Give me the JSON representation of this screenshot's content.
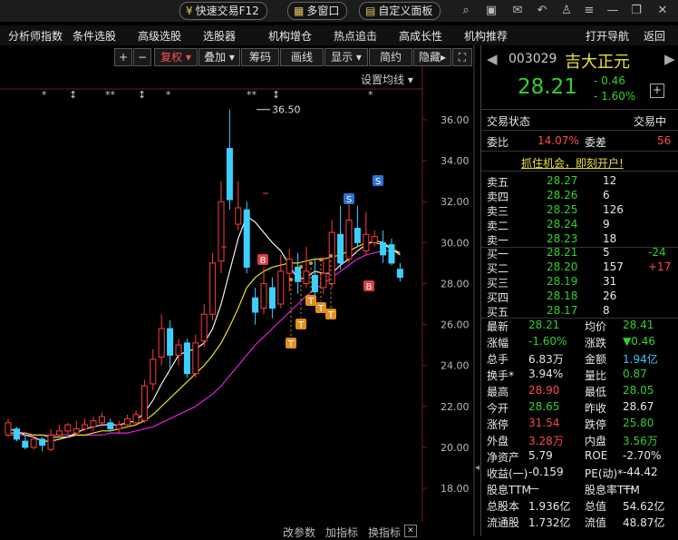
{
  "topbar": {
    "fast_trade": "快速交易F12",
    "multi_window": "多窗口",
    "custom_panel": "自定义面板"
  },
  "menu": [
    "分析师指数",
    "条件选股",
    "高级选股",
    "选股器",
    "机构增仓",
    "热点追击",
    "高成长性",
    "机构推荐",
    "打开导航",
    "返回"
  ],
  "toolbar": {
    "plus": "+",
    "minus": "−",
    "fuquan": "复权",
    "diejia": "叠加",
    "chouma": "筹码",
    "huaxian": "画线",
    "xianshi": "显示",
    "jianyue": "简约",
    "yincang": "隐藏",
    "settings_ma": "设置均线"
  },
  "bottom_toolbar": [
    "改参数",
    "加指标",
    "换指标"
  ],
  "chart_data": {
    "type": "candlestick",
    "ylim": [
      17,
      37
    ],
    "y_ticks": [
      "36.00",
      "34.00",
      "32.00",
      "30.00",
      "28.00",
      "26.00",
      "24.00",
      "22.00",
      "20.00",
      "18.00"
    ],
    "max_label": "36.50",
    "candles": [
      {
        "o": 20.6,
        "c": 21.2,
        "h": 21.4,
        "l": 20.5
      },
      {
        "o": 20.9,
        "c": 20.4,
        "h": 21.0,
        "l": 20.3
      },
      {
        "o": 20.3,
        "c": 20.0,
        "h": 20.6,
        "l": 19.9
      },
      {
        "o": 20.0,
        "c": 20.4,
        "h": 20.5,
        "l": 19.9
      },
      {
        "o": 20.4,
        "c": 20.1,
        "h": 20.5,
        "l": 19.8
      },
      {
        "o": 19.9,
        "c": 20.6,
        "h": 20.9,
        "l": 19.8
      },
      {
        "o": 20.6,
        "c": 20.8,
        "h": 21.1,
        "l": 20.5
      },
      {
        "o": 20.8,
        "c": 21.1,
        "h": 21.2,
        "l": 20.6
      },
      {
        "o": 20.7,
        "c": 20.9,
        "h": 21.3,
        "l": 20.6
      },
      {
        "o": 20.9,
        "c": 21.1,
        "h": 21.4,
        "l": 20.8
      },
      {
        "o": 21.0,
        "c": 21.3,
        "h": 21.5,
        "l": 20.8
      },
      {
        "o": 21.2,
        "c": 21.5,
        "h": 21.7,
        "l": 21.0
      },
      {
        "o": 21.2,
        "c": 20.9,
        "h": 21.4,
        "l": 20.8
      },
      {
        "o": 20.9,
        "c": 21.1,
        "h": 21.3,
        "l": 20.7
      },
      {
        "o": 21.1,
        "c": 21.4,
        "h": 21.6,
        "l": 21.0
      },
      {
        "o": 21.2,
        "c": 21.6,
        "h": 21.8,
        "l": 21.1
      },
      {
        "o": 21.3,
        "c": 23.0,
        "h": 23.3,
        "l": 21.2
      },
      {
        "o": 23.1,
        "c": 24.3,
        "h": 24.8,
        "l": 22.8
      },
      {
        "o": 24.4,
        "c": 25.8,
        "h": 26.5,
        "l": 24.0
      },
      {
        "o": 25.8,
        "c": 24.5,
        "h": 26.2,
        "l": 23.8
      },
      {
        "o": 24.5,
        "c": 25.0,
        "h": 25.3,
        "l": 24.0
      },
      {
        "o": 25.1,
        "c": 23.6,
        "h": 25.3,
        "l": 23.4
      },
      {
        "o": 23.6,
        "c": 25.1,
        "h": 25.5,
        "l": 23.4
      },
      {
        "o": 25.2,
        "c": 26.5,
        "h": 27.0,
        "l": 24.9
      },
      {
        "o": 26.5,
        "c": 29.0,
        "h": 29.5,
        "l": 26.2
      },
      {
        "o": 29.1,
        "c": 32.0,
        "h": 33.0,
        "l": 28.5
      },
      {
        "o": 34.6,
        "c": 32.1,
        "h": 36.5,
        "l": 31.6
      },
      {
        "o": 30.9,
        "c": 31.7,
        "h": 33.0,
        "l": 30.6
      },
      {
        "o": 31.6,
        "c": 28.8,
        "h": 32.0,
        "l": 28.5
      },
      {
        "o": 27.3,
        "c": 26.6,
        "h": 27.8,
        "l": 26.0
      },
      {
        "o": 26.8,
        "c": 28.0,
        "h": 28.8,
        "l": 26.5
      },
      {
        "o": 27.8,
        "c": 26.8,
        "h": 28.3,
        "l": 26.3
      },
      {
        "o": 27.0,
        "c": 28.6,
        "h": 29.4,
        "l": 26.8
      },
      {
        "o": 28.5,
        "c": 29.2,
        "h": 29.7,
        "l": 27.6
      },
      {
        "o": 28.8,
        "c": 28.1,
        "h": 29.5,
        "l": 27.5
      },
      {
        "o": 28.0,
        "c": 28.6,
        "h": 29.8,
        "l": 27.8
      },
      {
        "o": 28.4,
        "c": 27.6,
        "h": 29.2,
        "l": 27.1
      },
      {
        "o": 27.8,
        "c": 28.5,
        "h": 29.3,
        "l": 27.5
      },
      {
        "o": 28.0,
        "c": 30.5,
        "h": 31.1,
        "l": 27.8
      },
      {
        "o": 30.4,
        "c": 29.0,
        "h": 31.8,
        "l": 28.7
      },
      {
        "o": 29.2,
        "c": 31.1,
        "h": 32.0,
        "l": 29.0
      },
      {
        "o": 30.7,
        "c": 30.0,
        "h": 31.8,
        "l": 29.8
      },
      {
        "o": 29.6,
        "c": 30.4,
        "h": 31.5,
        "l": 29.4
      },
      {
        "o": 30.0,
        "c": 30.3,
        "h": 30.6,
        "l": 29.8
      },
      {
        "o": 30.0,
        "c": 29.4,
        "h": 30.6,
        "l": 29.0
      },
      {
        "o": 29.9,
        "c": 29.0,
        "h": 30.2,
        "l": 28.9
      },
      {
        "o": 28.7,
        "c": 28.3,
        "h": 29.0,
        "l": 28.1
      }
    ],
    "ma5": [
      20.9,
      20.8,
      20.6,
      20.5,
      20.3,
      20.3,
      20.4,
      20.5,
      20.7,
      20.9,
      21.0,
      21.1,
      21.1,
      21.1,
      21.2,
      21.3,
      21.7,
      22.3,
      23.1,
      23.8,
      24.5,
      24.7,
      24.8,
      25.1,
      25.8,
      27.0,
      28.6,
      30.2,
      31.3,
      31.0,
      30.5,
      30.0,
      29.6,
      28.9,
      28.2,
      28.3,
      28.6,
      28.5,
      28.5,
      28.9,
      29.2,
      29.6,
      29.9,
      30.1,
      30.0,
      29.7,
      29.4
    ],
    "ma10": [
      20.7,
      20.7,
      20.7,
      20.6,
      20.6,
      20.5,
      20.5,
      20.5,
      20.6,
      20.6,
      20.7,
      20.8,
      20.8,
      20.9,
      21.0,
      21.1,
      21.3,
      21.6,
      22.0,
      22.4,
      22.8,
      23.2,
      23.6,
      24.0,
      24.5,
      25.1,
      25.9,
      26.8,
      27.8,
      28.3,
      28.6,
      28.8,
      28.9,
      29.0,
      29.0,
      29.1,
      29.2,
      29.2,
      29.3,
      29.4,
      29.6,
      29.8,
      30.0,
      30.0,
      29.9,
      29.7,
      29.5
    ],
    "ma20": [
      20.6,
      20.6,
      20.6,
      20.6,
      20.6,
      20.6,
      20.6,
      20.6,
      20.6,
      20.6,
      20.6,
      20.6,
      20.7,
      20.7,
      20.7,
      20.8,
      20.9,
      21.0,
      21.2,
      21.4,
      21.6,
      21.8,
      22.0,
      22.3,
      22.6,
      23.0,
      23.5,
      24.0,
      24.5,
      25.0,
      25.4,
      25.8,
      26.2,
      26.6,
      27.0,
      27.4,
      27.7,
      28.0,
      28.3,
      28.6,
      28.9,
      29.2,
      29.4,
      29.5,
      29.6,
      29.6,
      29.5
    ]
  },
  "markers": {
    "top_symbols": [
      "*",
      "↕",
      "**",
      "↕",
      "*",
      "**",
      "↕",
      "*"
    ],
    "B": "B",
    "S": "S",
    "T": "T"
  },
  "stock": {
    "code": "003029",
    "name": "吉大正元",
    "price": "28.21",
    "change": "- 0.46",
    "change_pct": "- 1.60%"
  },
  "panel": {
    "trade_status_label": "交易状态",
    "trade_status_value": "交易中",
    "weibi_label": "委比",
    "weibi_value": "14.07%",
    "weicha_label": "委差",
    "weicha_value": "56",
    "promo": "抓住机会，即刻开户!",
    "asks": [
      {
        "label": "卖五",
        "price": "28.27",
        "vol": "12"
      },
      {
        "label": "卖四",
        "price": "28.26",
        "vol": "6"
      },
      {
        "label": "卖三",
        "price": "28.25",
        "vol": "126"
      },
      {
        "label": "卖二",
        "price": "28.24",
        "vol": "9"
      },
      {
        "label": "卖一",
        "price": "28.23",
        "vol": "18"
      }
    ],
    "bids": [
      {
        "label": "买一",
        "price": "28.21",
        "vol": "5",
        "delta": "-24"
      },
      {
        "label": "买二",
        "price": "28.20",
        "vol": "157",
        "delta": "+17"
      },
      {
        "label": "买三",
        "price": "28.19",
        "vol": "31",
        "delta": ""
      },
      {
        "label": "买四",
        "price": "28.18",
        "vol": "26",
        "delta": ""
      },
      {
        "label": "买五",
        "price": "28.17",
        "vol": "8",
        "delta": ""
      }
    ],
    "stats": [
      {
        "l1": "最新",
        "v1": "28.21",
        "c1": "green",
        "l2": "均价",
        "v2": "28.41",
        "c2": "green"
      },
      {
        "l1": "涨幅",
        "v1": "-1.60%",
        "c1": "green",
        "l2": "涨跌",
        "v2": "▼0.46",
        "c2": "green"
      },
      {
        "l1": "总手",
        "v1": "6.83万",
        "c1": "white",
        "l2": "金额",
        "v2": "1.94亿",
        "c2": "cyan"
      },
      {
        "l1": "换手*",
        "v1": "3.94%",
        "c1": "white",
        "l2": "量比",
        "v2": "0.87",
        "c2": "green"
      },
      {
        "l1": "最高",
        "v1": "28.90",
        "c1": "red",
        "l2": "最低",
        "v2": "28.05",
        "c2": "green"
      },
      {
        "l1": "今开",
        "v1": "28.65",
        "c1": "green",
        "l2": "昨收",
        "v2": "28.67",
        "c2": "white"
      },
      {
        "l1": "涨停",
        "v1": "31.54",
        "c1": "red",
        "l2": "跌停",
        "v2": "25.80",
        "c2": "green"
      },
      {
        "l1": "外盘",
        "v1": "3.28万",
        "c1": "red",
        "l2": "内盘",
        "v2": "3.56万",
        "c2": "green"
      },
      {
        "l1": "净资产",
        "v1": "5.79",
        "c1": "white",
        "l2": "ROE",
        "v2": "-2.70%",
        "c2": "white"
      },
      {
        "l1": "收益(一)",
        "v1": "-0.159",
        "c1": "white",
        "l2": "PE(动)*",
        "v2": "-44.42",
        "c2": "white"
      },
      {
        "l1": "股息TTM",
        "v1": "—",
        "c1": "white",
        "l2": "股息率TTM",
        "v2": "—",
        "c2": "white"
      },
      {
        "l1": "总股本",
        "v1": "1.936亿",
        "c1": "white",
        "l2": "总值",
        "v2": "54.62亿",
        "c2": "white"
      },
      {
        "l1": "流通股",
        "v1": "1.732亿",
        "c1": "white",
        "l2": "流值",
        "v2": "48.87亿",
        "c2": "white"
      }
    ]
  }
}
